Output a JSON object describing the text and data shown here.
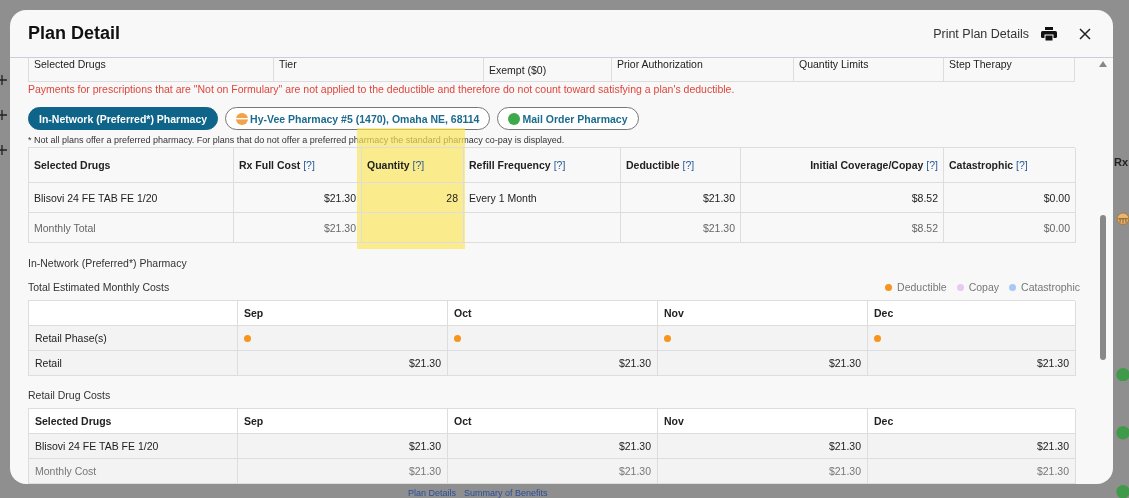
{
  "header": {
    "title": "Plan Detail",
    "print_label": "Print Plan Details"
  },
  "formulary_table": {
    "columns": [
      "Selected Drugs",
      "Tier",
      "Exempt ($0)",
      "Prior Authorization",
      "Quantity Limits",
      "Step Therapy"
    ]
  },
  "formulary_note": "Payments for prescriptions that are \"Not on Formulary\" are not applied to the deductible and therefore do not count toward satisfying a plan's deductible.",
  "pharmacy_tabs": [
    {
      "label": "In-Network (Preferred*) Pharmacy",
      "selected": true,
      "kind": "plain"
    },
    {
      "label": "Hy-Vee Pharmacy #5 (1470), Omaha NE, 68114",
      "selected": false,
      "kind": "half-circle"
    },
    {
      "label": "Mail Order Pharmacy",
      "selected": false,
      "kind": "dot"
    }
  ],
  "pharmacy_note": "* Not all plans offer a preferred pharmacy. For plans that do not offer a preferred pharmacy the standard pharmacy co-pay is displayed.",
  "cost_table": {
    "columns": [
      {
        "label": "Selected Drugs",
        "highlighted": false
      },
      {
        "label": "Rx Full Cost",
        "help": "[?]",
        "highlighted": false
      },
      {
        "label": "Quantity",
        "help": "[?]",
        "highlighted": true
      },
      {
        "label": "Refill Frequency",
        "help": "[?]",
        "highlighted": false
      },
      {
        "label": "Deductible",
        "help": "[?]",
        "highlighted": false
      },
      {
        "label": "Initial Coverage/Copay",
        "help": "[?]",
        "highlighted": false
      },
      {
        "label": "Catastrophic",
        "help": "[?]",
        "highlighted": false
      }
    ],
    "rows": [
      {
        "kind": "drug",
        "cells": [
          "Blisovi 24 FE TAB FE 1/20",
          "$21.30",
          "28",
          "Every 1 Month",
          "$21.30",
          "$8.52",
          "$0.00"
        ]
      },
      {
        "kind": "total",
        "cells": [
          "Monthly Total",
          "$21.30",
          null,
          null,
          "$21.30",
          "$8.52",
          "$0.00"
        ]
      }
    ]
  },
  "section_label": "In-Network (Preferred*) Pharmacy",
  "monthly_costs": {
    "title": "Total Estimated Monthly Costs",
    "legend": [
      {
        "label": "Deductible",
        "color": "#f7941d"
      },
      {
        "label": "Copay",
        "color": "#e8c8f4"
      },
      {
        "label": "Catastrophic",
        "color": "#a9c8f5"
      }
    ],
    "months": [
      "Sep",
      "Oct",
      "Nov",
      "Dec"
    ],
    "phase_label": "Retail Phase(s)",
    "phases": [
      {
        "color": "#f7941d"
      },
      {
        "color": "#f7941d"
      },
      {
        "color": "#f7941d"
      },
      {
        "color": "#f7941d"
      }
    ],
    "retail_label": "Retail",
    "retail": [
      "$21.30",
      "$21.30",
      "$21.30",
      "$21.30"
    ]
  },
  "retail_drug_costs": {
    "title": "Retail Drug Costs",
    "columns": [
      "Selected Drugs",
      "Sep",
      "Oct",
      "Nov",
      "Dec"
    ],
    "rows": [
      {
        "kind": "drug",
        "cells": [
          "Blisovi 24 FE TAB FE 1/20",
          "$21.30",
          "$21.30",
          "$21.30",
          "$21.30"
        ]
      },
      {
        "kind": "total",
        "cells": [
          "Monthly Cost",
          "$21.30",
          "$21.30",
          "$21.30",
          "$21.30"
        ]
      }
    ]
  },
  "background": {
    "rx_label": "Rx",
    "links": [
      "Plan Details",
      "Summary of Benefits"
    ]
  }
}
